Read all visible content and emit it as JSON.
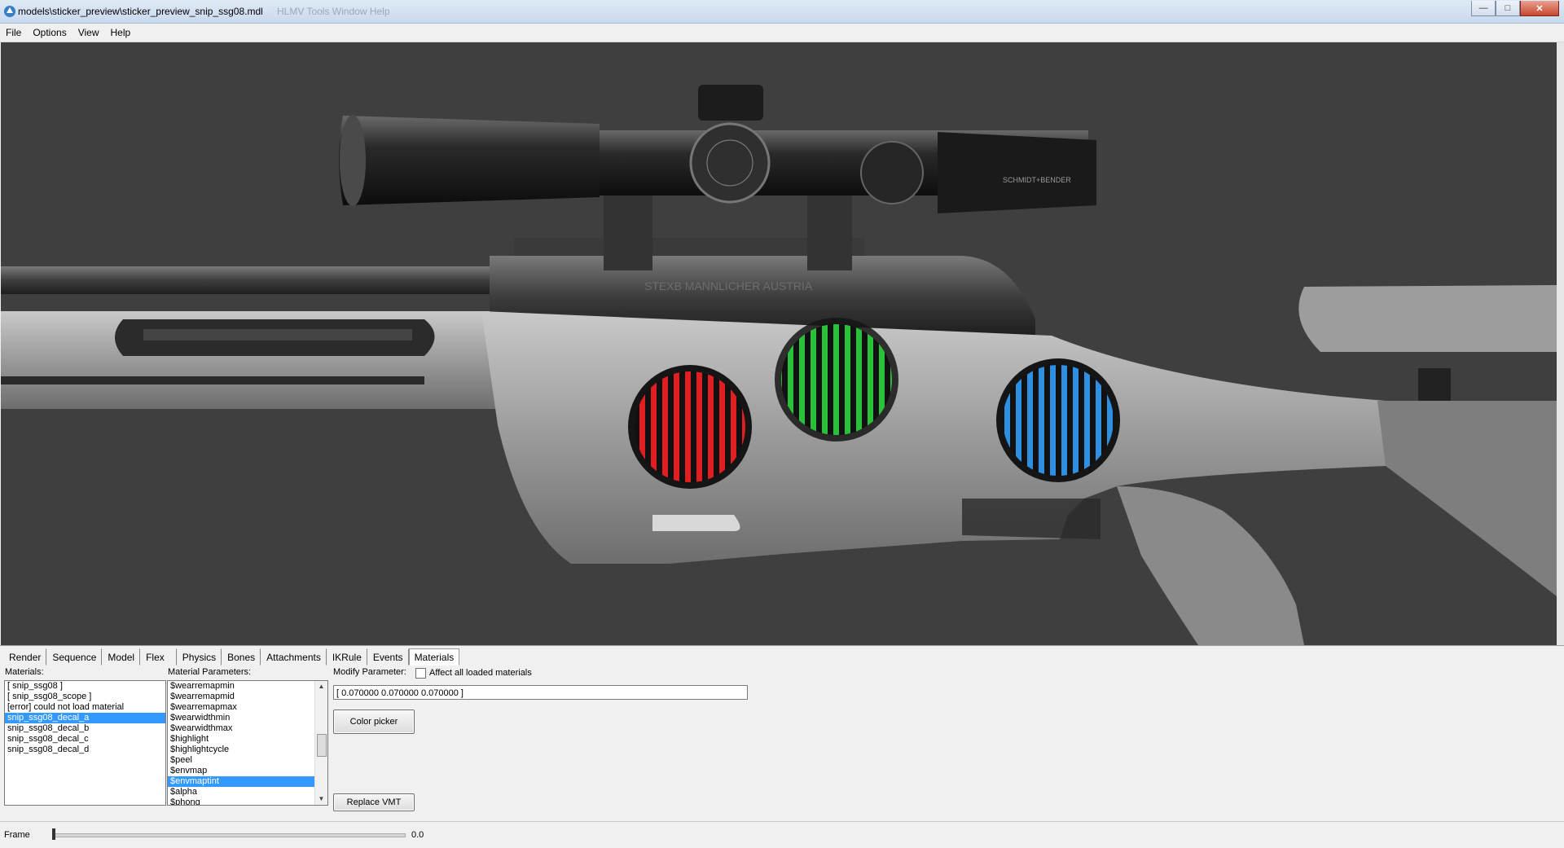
{
  "window": {
    "title": "models\\sticker_preview\\sticker_preview_snip_ssg08.mdl",
    "ghost_menu": "HLMV   Tools   Window   Help",
    "buttons": {
      "minimize": "—",
      "maximize": "□",
      "close": "✕"
    }
  },
  "menubar": {
    "items": [
      "File",
      "Options",
      "View",
      "Help"
    ]
  },
  "viewport": {
    "background_color": "#3f3f3f",
    "decals": [
      {
        "name": "red",
        "color": "#e11f22"
      },
      {
        "name": "green",
        "color": "#29c139"
      },
      {
        "name": "blue",
        "color": "#2f8fe0"
      }
    ],
    "engraving": "STEXB MANNLICHER AUSTRIA",
    "scope_brand": "SCHMIDT+BENDER"
  },
  "tabs": [
    {
      "label": "Render",
      "active": false
    },
    {
      "label": "Sequence",
      "active": false
    },
    {
      "label": "Model",
      "active": false
    },
    {
      "label": "Flex",
      "active": false
    },
    {
      "label": "Physics",
      "active": false
    },
    {
      "label": "Bones",
      "active": false
    },
    {
      "label": "Attachments",
      "active": false
    },
    {
      "label": "IKRule",
      "active": false
    },
    {
      "label": "Events",
      "active": false
    },
    {
      "label": "Materials",
      "active": true
    }
  ],
  "materials": {
    "label": "Materials:",
    "items": [
      {
        "text": "[ snip_ssg08 ]",
        "selected": false
      },
      {
        "text": "[ snip_ssg08_scope ]",
        "selected": false
      },
      {
        "text": "[error] could not load material",
        "selected": false
      },
      {
        "text": "snip_ssg08_decal_a",
        "selected": true
      },
      {
        "text": "snip_ssg08_decal_b",
        "selected": false
      },
      {
        "text": "snip_ssg08_decal_c",
        "selected": false
      },
      {
        "text": "snip_ssg08_decal_d",
        "selected": false
      }
    ]
  },
  "material_parameters": {
    "label": "Material Parameters:",
    "items": [
      {
        "text": "$wearremapmin",
        "selected": false
      },
      {
        "text": "$wearremapmid",
        "selected": false
      },
      {
        "text": "$wearremapmax",
        "selected": false
      },
      {
        "text": "$wearwidthmin",
        "selected": false
      },
      {
        "text": "$wearwidthmax",
        "selected": false
      },
      {
        "text": "$highlight",
        "selected": false
      },
      {
        "text": "$highlightcycle",
        "selected": false
      },
      {
        "text": "$peel",
        "selected": false
      },
      {
        "text": "$envmap",
        "selected": false
      },
      {
        "text": "$envmaptint",
        "selected": true
      },
      {
        "text": "$alpha",
        "selected": false
      },
      {
        "text": "$phong",
        "selected": false
      }
    ]
  },
  "modify": {
    "label": "Modify Parameter:",
    "affect_all_label": "Affect all loaded materials",
    "affect_all_checked": false,
    "value": "[ 0.070000 0.070000 0.070000 ]",
    "color_picker_label": "Color picker",
    "replace_vmt_label": "Replace VMT"
  },
  "frame": {
    "label": "Frame",
    "value": "0.0",
    "position_fraction": 0.0
  }
}
